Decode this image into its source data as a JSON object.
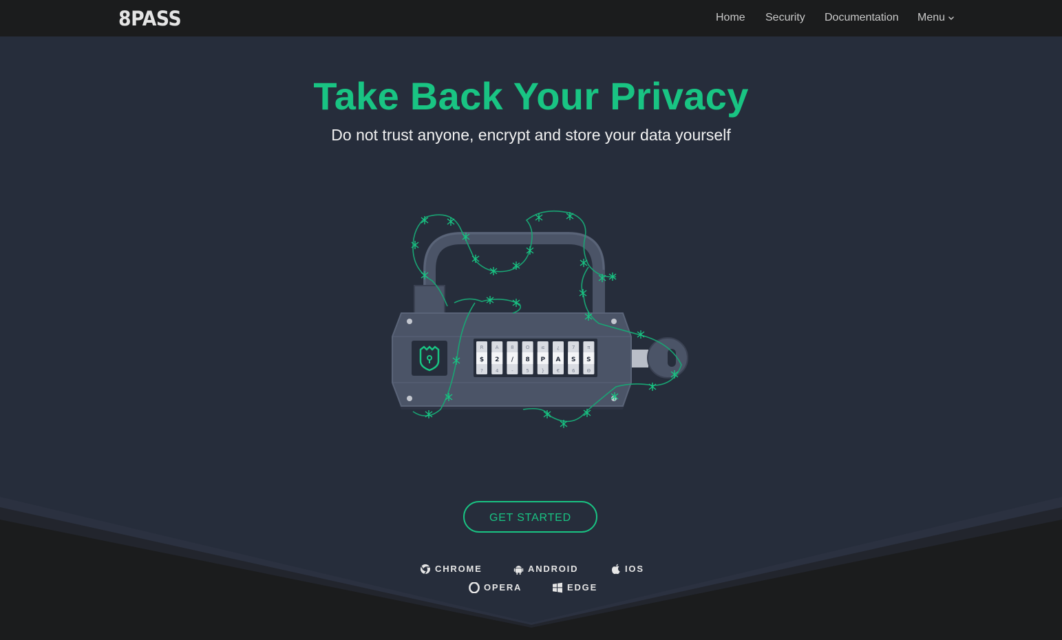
{
  "brand": {
    "logo_text": "8PASS"
  },
  "nav": {
    "home": "Home",
    "security": "Security",
    "documentation": "Documentation",
    "menu": "Menu"
  },
  "hero": {
    "title": "Take Back Your Privacy",
    "subtitle": "Do not trust anyone, encrypt and store your data yourself",
    "cta_label": "GET STARTED"
  },
  "lock_dials": [
    [
      "R",
      "$",
      "?"
    ],
    [
      "A",
      "2",
      "4"
    ],
    [
      "8",
      "/",
      "-"
    ],
    [
      "O",
      "8",
      "5"
    ],
    [
      "≤",
      "P",
      "}"
    ],
    [
      "¿",
      "A",
      "€"
    ],
    [
      "7",
      "S",
      "6"
    ],
    [
      "π",
      "S",
      "Θ"
    ]
  ],
  "platforms": [
    {
      "label": "CHROME",
      "icon": "chrome-icon"
    },
    {
      "label": "ANDROID",
      "icon": "android-icon"
    },
    {
      "label": "IOS",
      "icon": "apple-icon"
    },
    {
      "label": "OPERA",
      "icon": "opera-icon"
    },
    {
      "label": "EDGE",
      "icon": "windows-icon"
    }
  ],
  "colors": {
    "accent": "#19c483",
    "background": "#262d3b",
    "navbar": "#1b1c1d",
    "footer": "#1b1c1d",
    "lock_body": "#4b5467"
  }
}
